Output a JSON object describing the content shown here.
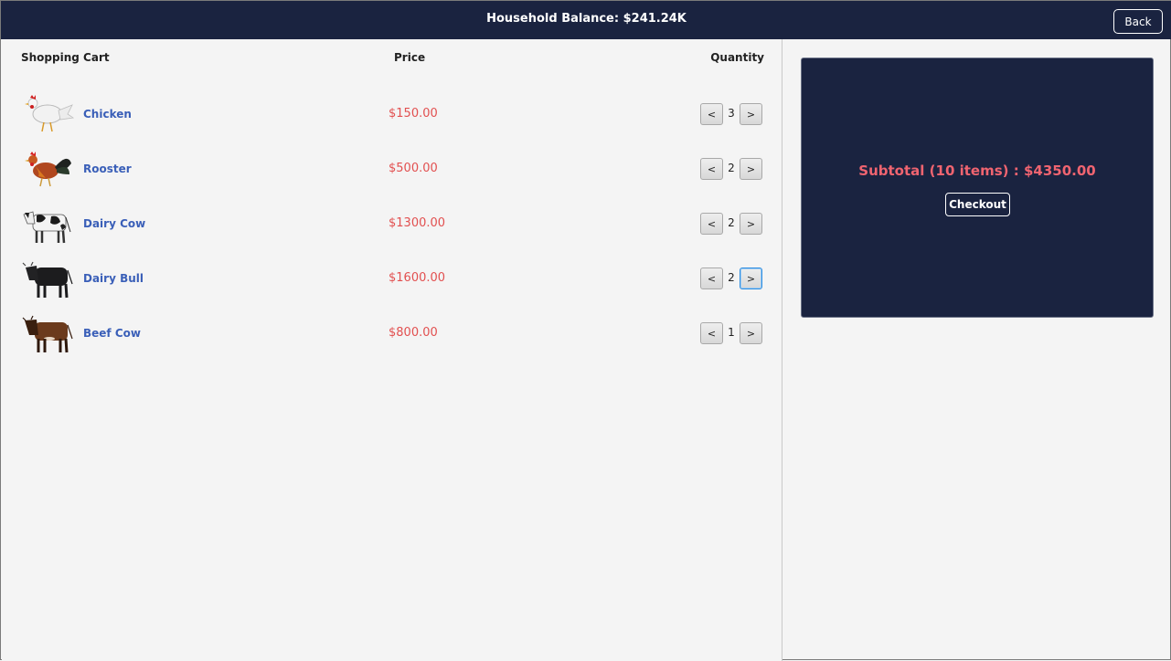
{
  "header": {
    "balance_title": "Household Balance: $241.24K",
    "back_label": "Back"
  },
  "cart": {
    "columns": {
      "item": "Shopping Cart",
      "price": "Price",
      "quantity": "Quantity"
    },
    "decrement_label": "<",
    "increment_label": ">",
    "items": [
      {
        "name": "Chicken",
        "price": "$150.00",
        "qty": "3",
        "image": "chicken-image"
      },
      {
        "name": "Rooster",
        "price": "$500.00",
        "qty": "2",
        "image": "rooster-image"
      },
      {
        "name": "Dairy Cow",
        "price": "$1300.00",
        "qty": "2",
        "image": "dairy-cow-image"
      },
      {
        "name": "Dairy Bull",
        "price": "$1600.00",
        "qty": "2",
        "image": "dairy-bull-image"
      },
      {
        "name": "Beef Cow",
        "price": "$800.00",
        "qty": "1",
        "image": "beef-cow-image"
      }
    ]
  },
  "summary": {
    "subtotal": "Subtotal (10 items) : $4350.00",
    "checkout_label": "Checkout"
  },
  "colors": {
    "navy": "#1a2340",
    "price_red": "#e25050",
    "subtotal_red": "#f06470",
    "name_blue": "#3a5fb8",
    "panel_bg": "#f4f4f4"
  }
}
